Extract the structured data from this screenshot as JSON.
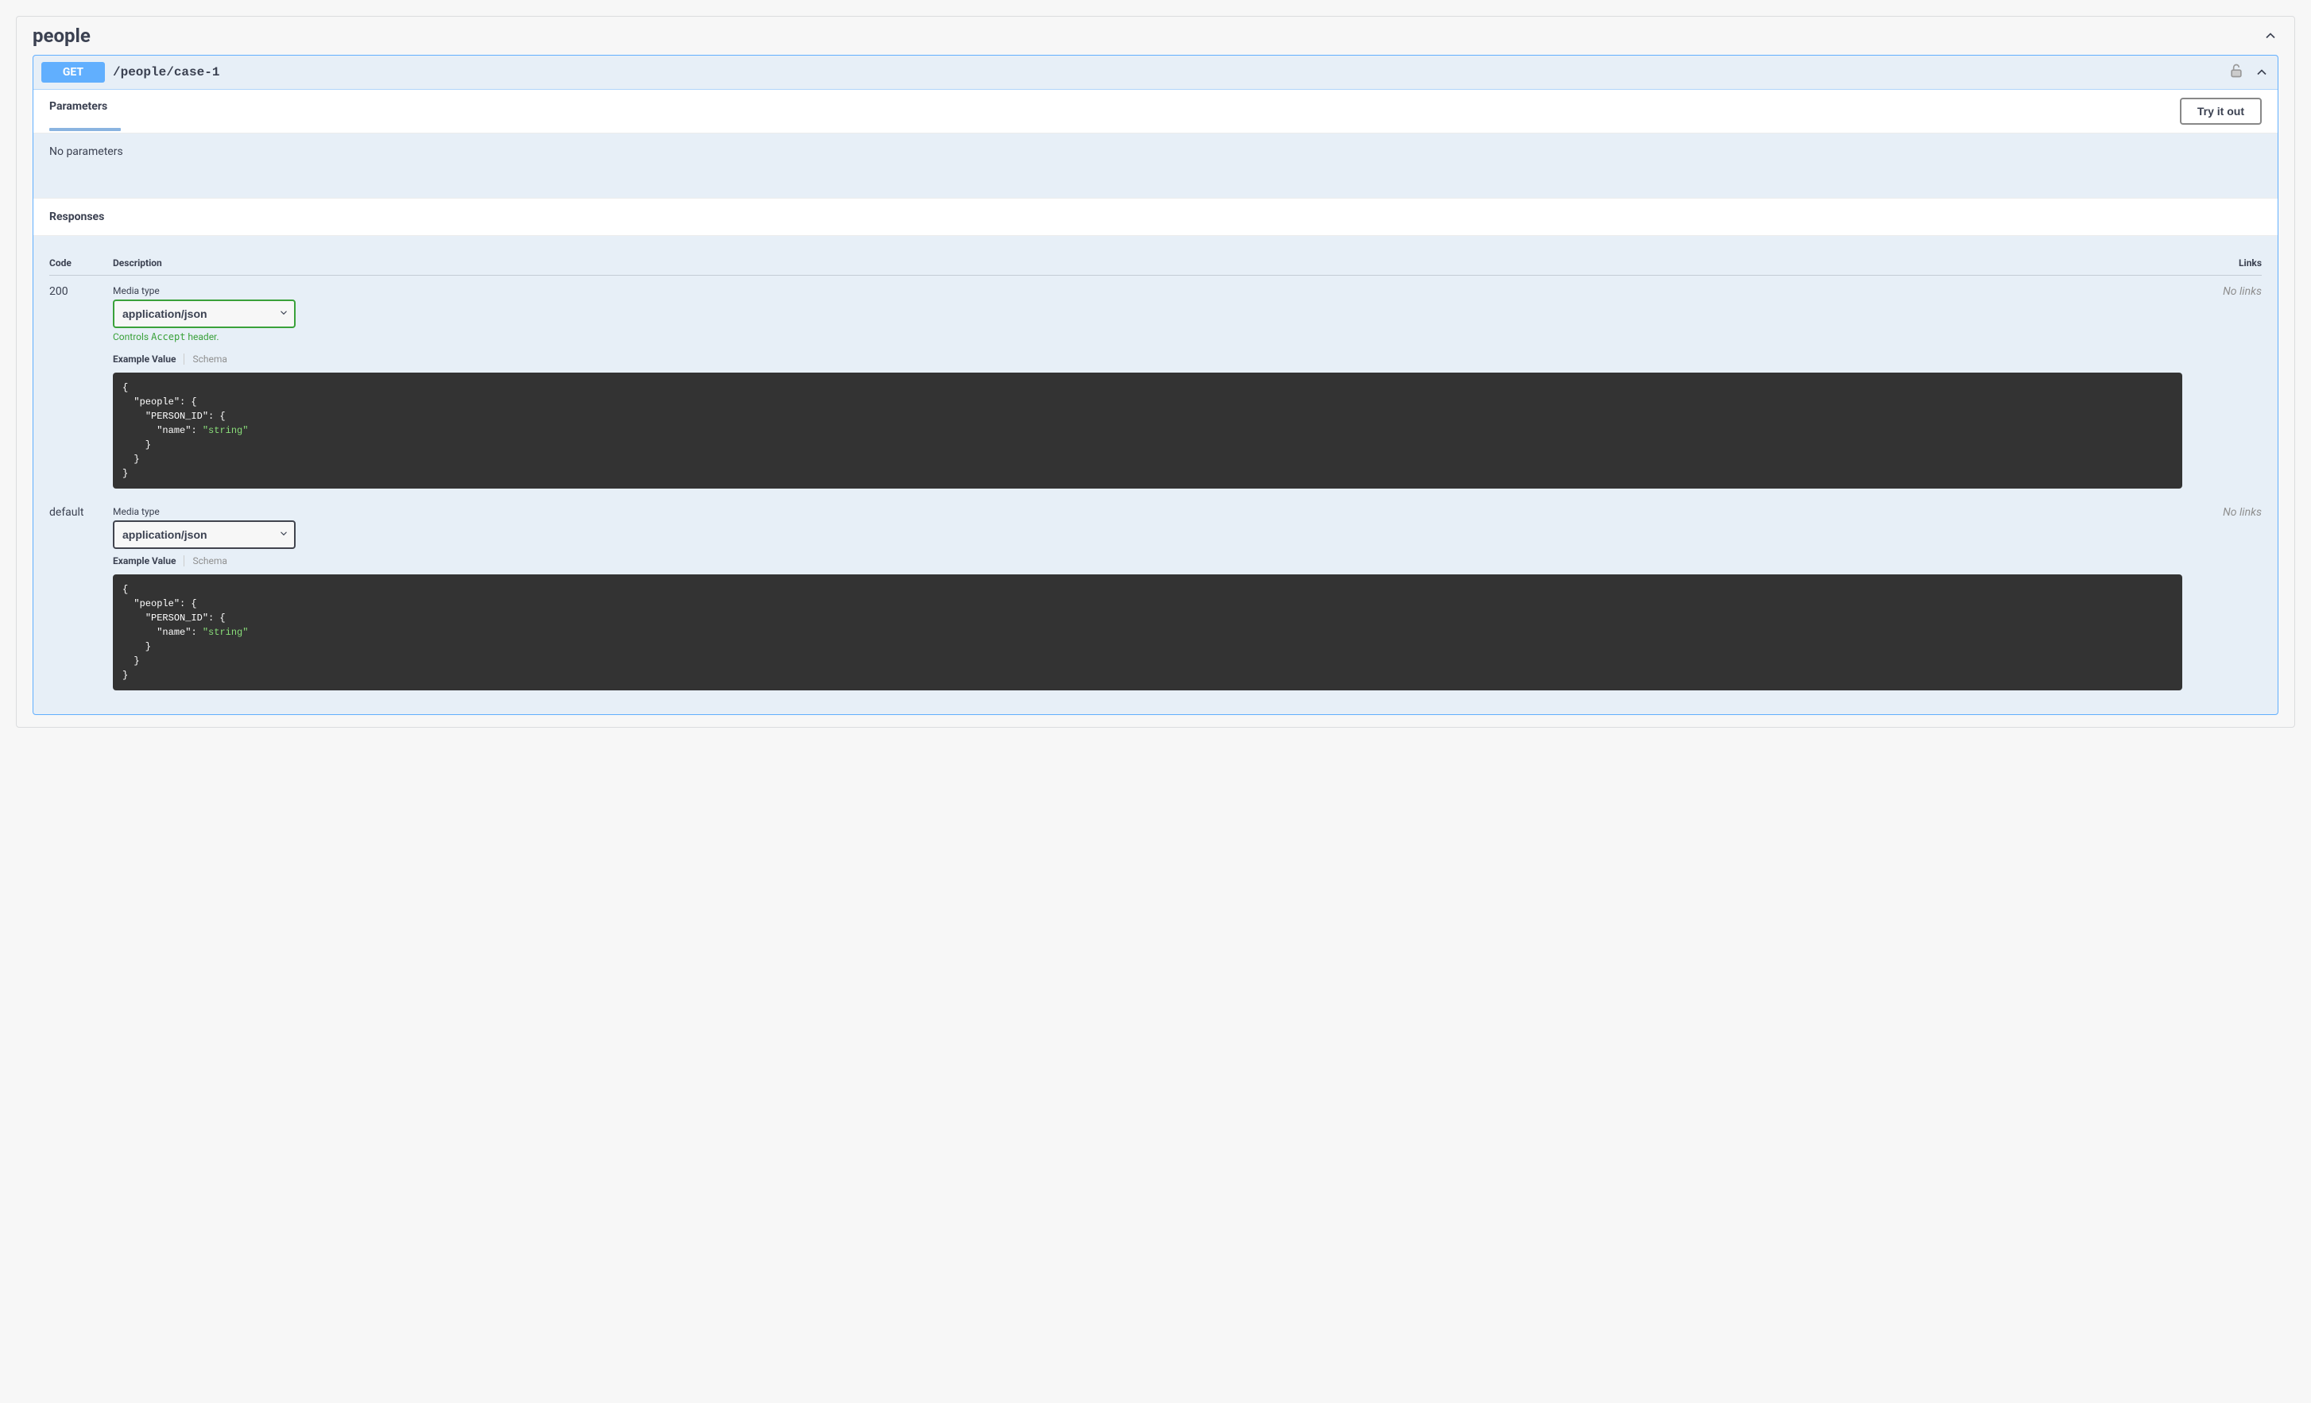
{
  "tag": {
    "name": "people"
  },
  "operation": {
    "method": "GET",
    "path": "/people/case-1"
  },
  "parameters": {
    "title": "Parameters",
    "try_it_out": "Try it out",
    "no_params": "No parameters"
  },
  "responses": {
    "title": "Responses",
    "headers": {
      "code": "Code",
      "description": "Description",
      "links": "Links"
    },
    "media_type_label": "Media type",
    "example_value_label": "Example Value",
    "schema_label": "Schema",
    "controls_accept_prefix": "Controls ",
    "controls_accept_code": "Accept",
    "controls_accept_suffix": " header.",
    "rows": [
      {
        "code": "200",
        "media_type": "application/json",
        "show_accept_hint": true,
        "example": "{\n  \"people\": {\n    \"PERSON_ID\": {\n      \"name\": \"string\"\n    }\n  }\n}",
        "links": "No links"
      },
      {
        "code": "default",
        "media_type": "application/json",
        "show_accept_hint": false,
        "example": "{\n  \"people\": {\n    \"PERSON_ID\": {\n      \"name\": \"string\"\n    }\n  }\n}",
        "links": "No links"
      }
    ]
  }
}
